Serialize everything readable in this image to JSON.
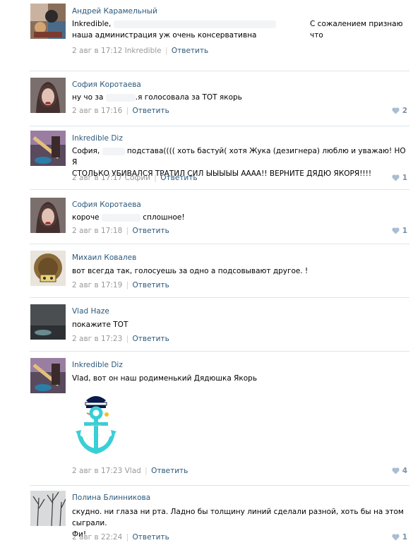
{
  "comments": [
    {
      "author": "Андрей Карамельный",
      "text_a": "Inkredible,",
      "text_b": "С сожалением признаю что",
      "text_c": "наша администрация уж очень консервативна",
      "date": "2 авг в 17:12",
      "reply_to": "Inkredible",
      "reply": "Ответить",
      "likes": ""
    },
    {
      "author": "София Коротаева",
      "text_a": "ну чо за",
      "text_b": ".я голосовала за ТОТ якорь",
      "date": "2 авг в 17:16",
      "reply": "Ответить",
      "likes": "2"
    },
    {
      "author": "Inkredible Diz",
      "text_a": "София,",
      "text_b": "подстава(((( хоть бастуй( хотя Жука (дезигнера) люблю и уважаю! НО Я",
      "text_c": "СТОЛЬКО УБИВАЛСЯ ТРАТИЛ СИЛ ЫЫЫЫЫ АААА!! ВЕРНИТЕ ДЯДЮ ЯКОРЯ!!!!",
      "date": "2 авг в 17:17",
      "reply_to": "Софии",
      "reply": "Ответить",
      "likes": "1"
    },
    {
      "author": "София Коротаева",
      "text_a": "короче",
      "text_b": "сплошное!",
      "date": "2 авг в 17:18",
      "reply": "Ответить",
      "likes": "1"
    },
    {
      "author": "Михаил Ковалев",
      "text_a": "вот всегда так, голосуешь за одно а подсовывают другое. !",
      "date": "2 авг в 17:19",
      "reply": "Ответить",
      "likes": ""
    },
    {
      "author": "Vlad Haze",
      "text_a": "покажите ТОТ",
      "date": "2 авг в 17:23",
      "reply": "Ответить",
      "likes": ""
    },
    {
      "author": "Inkredible Diz",
      "text_a": "Vlad, вот он наш родименький Дядюшка Якорь",
      "date": "2 авг в 17:23",
      "reply_to": "Vlad",
      "reply": "Ответить",
      "likes": "4"
    },
    {
      "author": "Полина Блинникова",
      "text_a": "скудно. ни глаза ни рта. Ладно бы толщину линий сделали разной, хоть бы на этом сыграли.",
      "text_c": "Фи!",
      "date": "2 авг в 22:24",
      "reply": "Ответить",
      "likes": "1"
    }
  ],
  "colors": {
    "link": "#2b587a",
    "meta": "#999999",
    "like": "#7991ad",
    "separator": "#dfe4ea"
  },
  "icons": {
    "like": "heart-icon",
    "attachment": "anchor-sailor-image"
  }
}
